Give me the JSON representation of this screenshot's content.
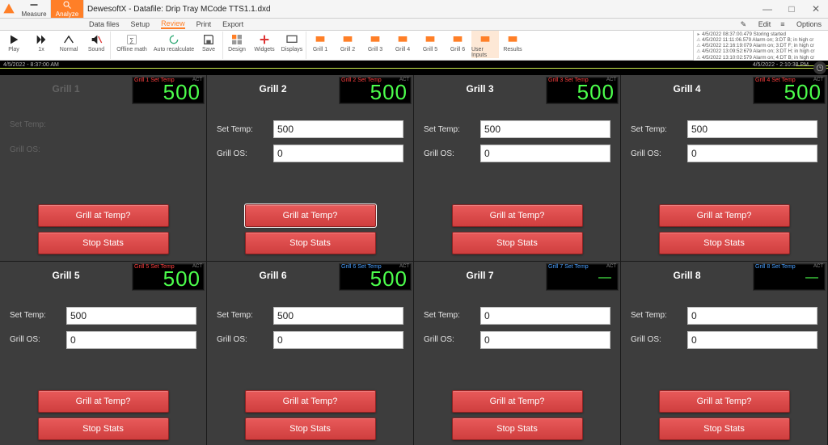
{
  "app": {
    "title": "DewesoftX - Datafile: Drip Tray MCode TTS1.1.dxd",
    "top_tabs": {
      "measure": "Measure",
      "analyze": "Analyze"
    },
    "menu": [
      "Data files",
      "Setup",
      "Review",
      "Print",
      "Export"
    ],
    "menu_active": "Review",
    "right_menu": {
      "edit": "Edit",
      "options": "Options"
    }
  },
  "toolbar": {
    "play": "Play",
    "one_x": "1x",
    "normal": "Normal",
    "sound": "Sound",
    "offline_math": "Offline math",
    "auto_recalc": "Auto recalculate",
    "save": "Save",
    "design": "Design",
    "widgets": "Widgets",
    "displays": "Displays",
    "grill1": "Grill 1",
    "grill2": "Grill 2",
    "grill3": "Grill 3",
    "grill4": "Grill 4",
    "grill5": "Grill 5",
    "grill6": "Grill 6",
    "user_inputs": "User Inputs",
    "results": "Results"
  },
  "log": [
    "4/5/2022 08:37:00.479 Storing started",
    "4/5/2022 11:11:06.579 Alarm on; 3:DT B; in high cr",
    "4/5/2022 12:16:19:079 Alarm on; 3:DT F; in high cr",
    "4/5/2022 13:09:52:679 Alarm on; 3:DT H; in high cr",
    "4/5/2022 13:10:02:579 Alarm on; 4:DT B; in high cr"
  ],
  "timeline": {
    "left_ts": "4/5/2022 - 8:37:00 AM",
    "right_ts": "4/5/2022 - 2:10:38 PM"
  },
  "labels": {
    "set_temp": "Set Temp:",
    "grill_os": "Grill OS:",
    "grill_at_temp": "Grill at Temp?",
    "stop_stats": "Stop Stats",
    "act": "ACT"
  },
  "grills": [
    {
      "title": "Grill 1",
      "lcd_title": "Grill 1 Set Temp",
      "lcd_val": "500",
      "fields": false,
      "muted": true
    },
    {
      "title": "Grill 2",
      "lcd_title": "Grill 2 Set Temp",
      "lcd_val": "500",
      "set": "500",
      "os": "0",
      "sel": true
    },
    {
      "title": "Grill 3",
      "lcd_title": "Grill 3 Set Temp",
      "lcd_val": "500",
      "set": "500",
      "os": "0"
    },
    {
      "title": "Grill 4",
      "lcd_title": "Grill 4 Set Temp",
      "lcd_val": "500",
      "set": "500",
      "os": "0"
    },
    {
      "title": "Grill 5",
      "lcd_title": "Grill 5 Set Temp",
      "lcd_val": "500",
      "set": "500",
      "os": "0"
    },
    {
      "title": "Grill 6",
      "lcd_title": "Grill 6 Set Temp",
      "lcd_val": "500",
      "set": "500",
      "os": "0",
      "lcd_blue": true
    },
    {
      "title": "Grill 7",
      "lcd_title": "Grill 7 Set Temp",
      "lcd_dash": true,
      "set": "0",
      "os": "0",
      "lcd_blue": true
    },
    {
      "title": "Grill 8",
      "lcd_title": "Grill 8 Set Temp",
      "lcd_dash": true,
      "set": "0",
      "os": "0",
      "lcd_blue": true
    }
  ]
}
